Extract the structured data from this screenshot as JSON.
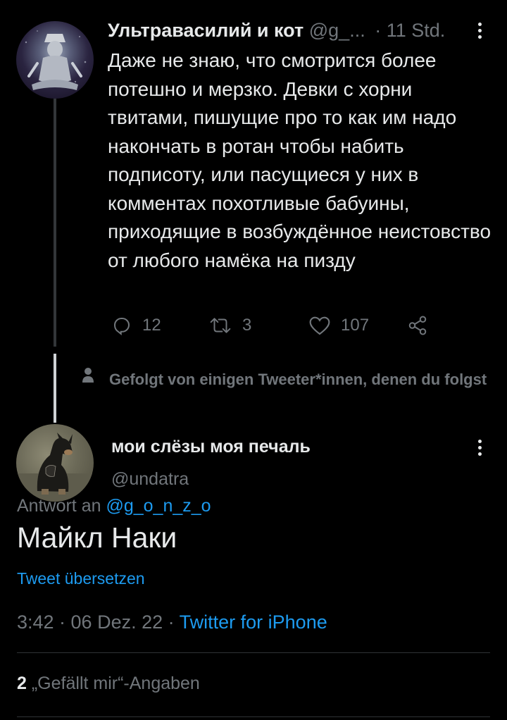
{
  "tweet1": {
    "display_name": "Ультравасилий и кот",
    "handle": "@g_...",
    "time": "· 11 Std.",
    "text": "Даже не знаю, что смотрится более потешно и мерзко. Девки с хорни твитами, пишущие про то как им надо накончать в ротан чтобы набить подписоту, или пасущиеся у них в комментах похотливые бабуины, приходящие в возбуждённое неистовство от любого намёка на пизду",
    "replies": "12",
    "retweets": "3",
    "likes": "107"
  },
  "social_context": "Gefolgt von einigen Tweeter*innen, denen du folgst",
  "tweet2": {
    "display_name": "мои слёзы моя печаль",
    "handle": "@undatra",
    "reply_prefix": "Antwort an",
    "reply_to": "@g_o_n_z_o",
    "text": "Майкл Наки",
    "translate": "Tweet übersetzen",
    "time": "3:42 · 06 Dez. 22 ·",
    "source": "Twitter for iPhone",
    "likes_count": "2",
    "likes_label": "„Gefällt mir“-Angaben"
  },
  "icons": {
    "reply": "reply-icon",
    "retweet": "retweet-icon",
    "like": "heart-icon",
    "share": "share-icon",
    "more": "more-icon",
    "person": "person-icon"
  },
  "colors": {
    "background": "#000000",
    "text": "#e7e9ea",
    "muted": "#71767b",
    "accent": "#1d9bf0"
  }
}
